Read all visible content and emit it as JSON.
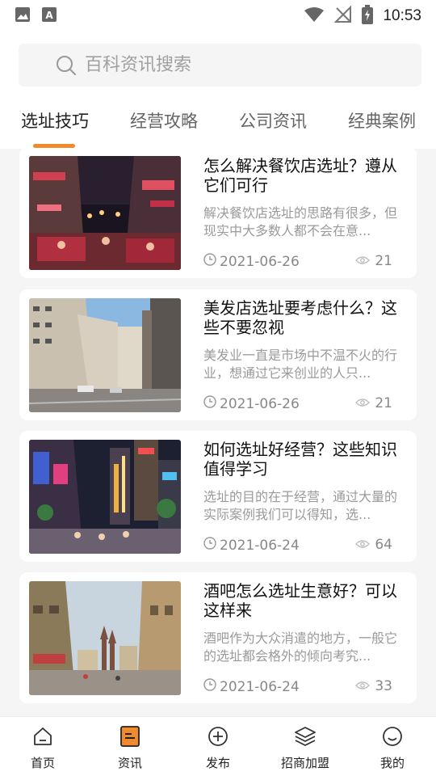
{
  "status_bar": {
    "time": "10:53",
    "icons": [
      "image-icon",
      "a-notification-icon",
      "wifi-icon",
      "no-signal-icon",
      "battery-charging-icon"
    ]
  },
  "search": {
    "placeholder": "百科资讯搜索"
  },
  "tabs": [
    {
      "label": "选址技巧",
      "active": true
    },
    {
      "label": "经营攻略",
      "active": false
    },
    {
      "label": "公司资讯",
      "active": false
    },
    {
      "label": "经典案例",
      "active": false
    }
  ],
  "articles": [
    {
      "title": "怎么解决餐饮店选址？遵从它们可行",
      "description": "解决餐饮店选址的思路有很多，但现实中大多数人都不会在意...",
      "date": "2021-06-26",
      "views": "21",
      "image": "night-street-photo"
    },
    {
      "title": "美发店选址要考虑什么？这些不要忽视",
      "description": "美发业一直是市场中不温不火的行业，想通过它来创业的人只...",
      "date": "2021-06-26",
      "views": "21",
      "image": "city-street-photo"
    },
    {
      "title": "如何选址好经营？这些知识值得学习",
      "description": "选址的目的在于经营，通过大量的实际案例我们可以得知，选...",
      "date": "2021-06-24",
      "views": "64",
      "image": "pedestrian-street-night-photo"
    },
    {
      "title": "酒吧怎么选址生意好？可以这样来",
      "description": "酒吧作为大众消遣的地方，一般它的选址都会格外的倾向考究...",
      "date": "2021-06-24",
      "views": "33",
      "image": "european-street-photo"
    }
  ],
  "bottom_nav": [
    {
      "label": "首页",
      "icon": "home-icon",
      "active": false
    },
    {
      "label": "资讯",
      "icon": "news-icon",
      "active": true
    },
    {
      "label": "发布",
      "icon": "plus-circle-icon",
      "active": false
    },
    {
      "label": "招商加盟",
      "icon": "layers-icon",
      "active": false
    },
    {
      "label": "我的",
      "icon": "smile-icon",
      "active": false
    }
  ],
  "colors": {
    "accent": "#f08a2c",
    "background": "#f5f5f5"
  }
}
